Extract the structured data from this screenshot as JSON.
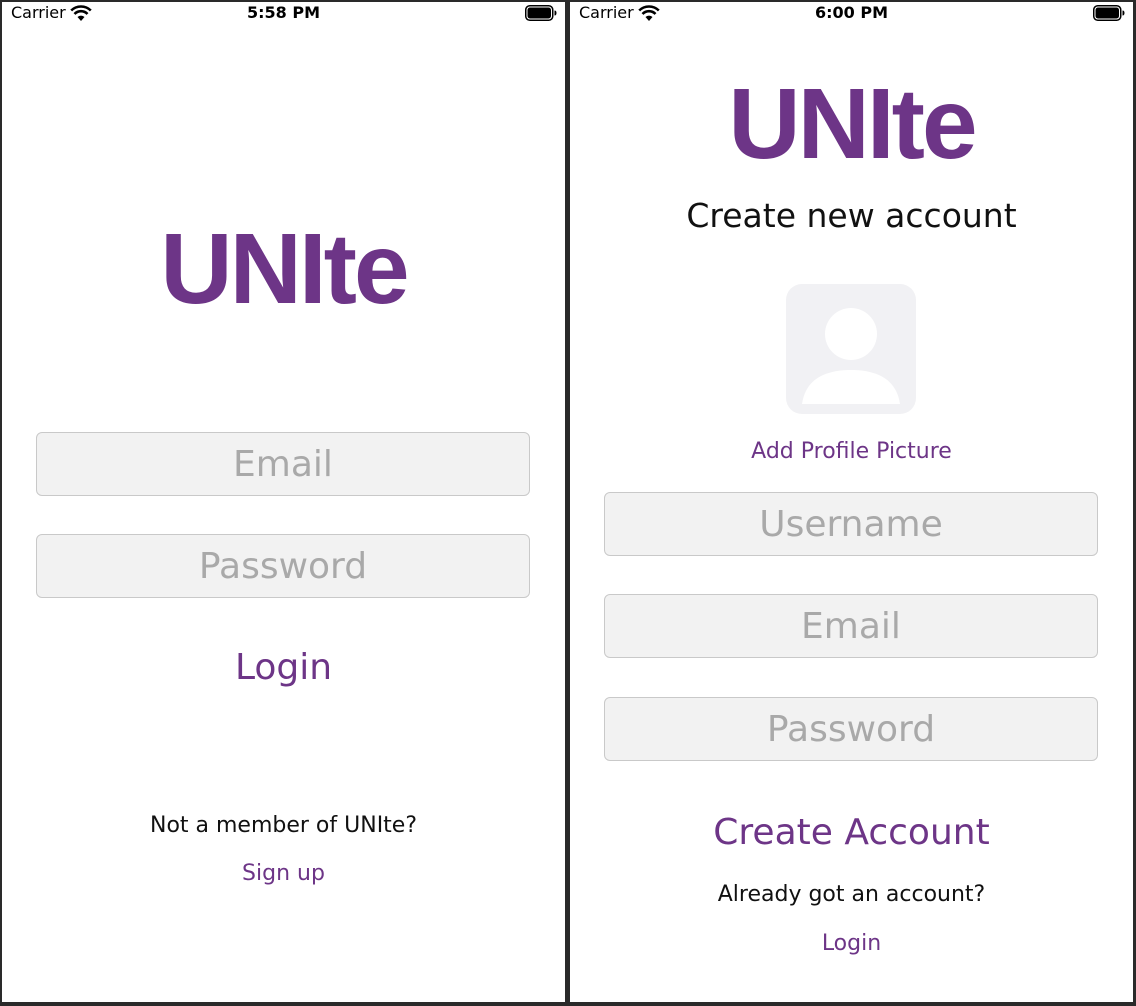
{
  "theme": {
    "accent": "#6d3587",
    "field_bg": "#f2f2f2",
    "placeholder": "#a9a9a9"
  },
  "login_screen": {
    "status_bar": {
      "carrier": "Carrier",
      "time": "5:58 PM"
    },
    "logo": "UNIte",
    "email": {
      "placeholder": "Email",
      "value": ""
    },
    "password": {
      "placeholder": "Password",
      "value": ""
    },
    "login_label": "Login",
    "not_member_text": "Not a member of UNIte?",
    "signup_label": "Sign up"
  },
  "signup_screen": {
    "status_bar": {
      "carrier": "Carrier",
      "time": "6:00 PM"
    },
    "logo": "UNIte",
    "title": "Create new account",
    "avatar_icon": "person-placeholder-icon",
    "add_photo_label": "Add Profile Picture",
    "username": {
      "placeholder": "Username",
      "value": ""
    },
    "email": {
      "placeholder": "Email",
      "value": ""
    },
    "password": {
      "placeholder": "Password",
      "value": ""
    },
    "create_label": "Create Account",
    "already_text": "Already got an account?",
    "login_label": "Login"
  }
}
